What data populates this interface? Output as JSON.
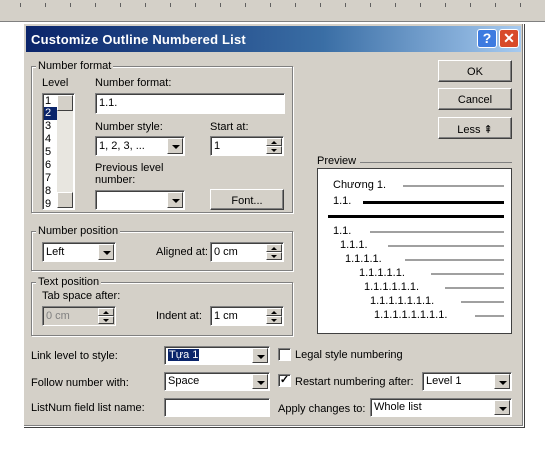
{
  "dialog": {
    "title": "Customize Outline Numbered List",
    "help_glyph": "?",
    "close_glyph": "✕"
  },
  "number_format": {
    "group_label": "Number format",
    "level_label": "Level",
    "levels": [
      "1",
      "2",
      "3",
      "4",
      "5",
      "6",
      "7",
      "8",
      "9"
    ],
    "selected_level": "2",
    "format_label": "Number format:",
    "format_value": "1.1.",
    "style_label": "Number style:",
    "style_value": "1, 2, 3, ...",
    "start_label": "Start at:",
    "start_value": "1",
    "prev_label_1": "Previous level",
    "prev_label_2": "number:",
    "prev_value": "",
    "font_button": "Font..."
  },
  "buttons": {
    "ok": "OK",
    "cancel": "Cancel",
    "less": "Less ⇞"
  },
  "number_position": {
    "group_label": "Number position",
    "align_value": "Left",
    "aligned_at_label": "Aligned at:",
    "aligned_at_value": "0 cm"
  },
  "text_position": {
    "group_label": "Text position",
    "tab_label": "Tab space after:",
    "tab_value": "0 cm",
    "indent_label": "Indent at:",
    "indent_value": "1 cm"
  },
  "preview": {
    "label": "Preview",
    "lines": [
      "Chương 1.",
      "1.1.",
      "1.1.",
      "1.1.1.",
      "1.1.1.1.",
      "1.1.1.1.1.",
      "1.1.1.1.1.1.",
      "1.1.1.1.1.1.1.",
      "1.1.1.1.1.1.1.1."
    ]
  },
  "bottom": {
    "link_label": "Link level to style:",
    "link_value": "Tựa 1",
    "legal_label": "Legal style numbering",
    "legal_checked": false,
    "follow_label": "Follow number with:",
    "follow_value": "Space",
    "restart_label": "Restart numbering after:",
    "restart_checked": true,
    "restart_value": "Level 1",
    "listnum_label": "ListNum field list name:",
    "listnum_value": "",
    "apply_label": "Apply changes to:",
    "apply_value": "Whole list"
  }
}
